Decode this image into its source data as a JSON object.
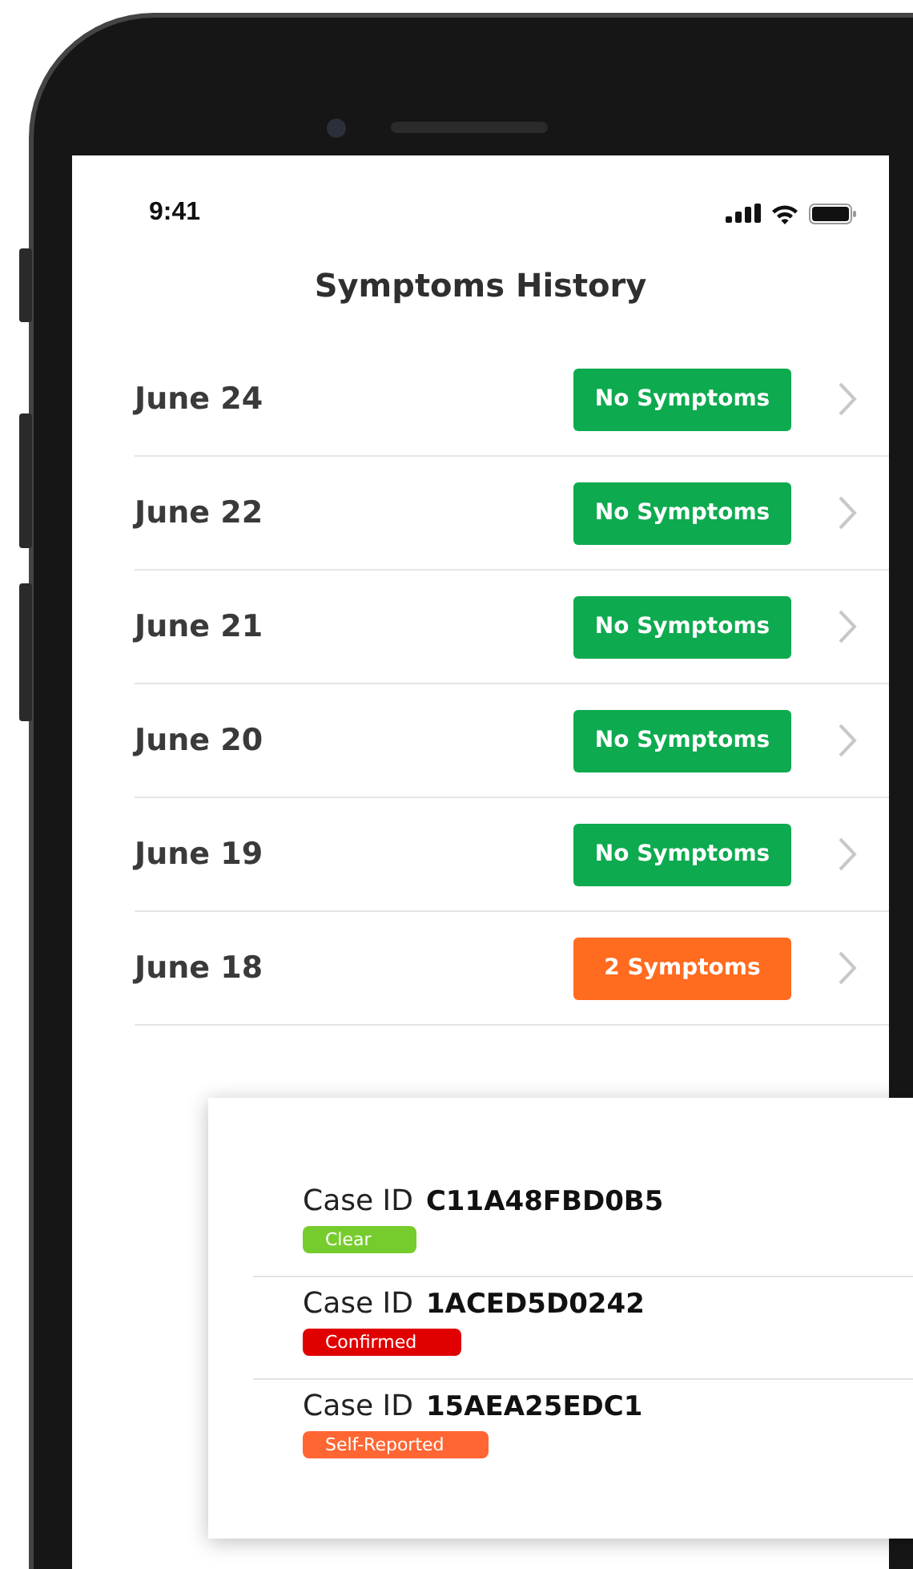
{
  "status_bar": {
    "time": "9:41"
  },
  "title": "Symptoms History",
  "history": [
    {
      "date": "June 24",
      "status": "No Symptoms",
      "kind": "none"
    },
    {
      "date": "June 22",
      "status": "No Symptoms",
      "kind": "none"
    },
    {
      "date": "June 21",
      "status": "No Symptoms",
      "kind": "none"
    },
    {
      "date": "June 20",
      "status": "No Symptoms",
      "kind": "none"
    },
    {
      "date": "June 19",
      "status": "No Symptoms",
      "kind": "none"
    },
    {
      "date": "June 18",
      "status": "2 Symptoms",
      "kind": "symptoms"
    }
  ],
  "cases": [
    {
      "label": "Case ID",
      "id": "C11A48FBD0B5",
      "tag": "Clear",
      "color": "#76cc2d"
    },
    {
      "label": "Case ID",
      "id": "1ACED5D0242",
      "tag": "Confirmed",
      "color": "#e00000"
    },
    {
      "label": "Case ID",
      "id": "15AEA25EDC1",
      "tag": "Self-Reported",
      "color": "#ff6633"
    }
  ]
}
